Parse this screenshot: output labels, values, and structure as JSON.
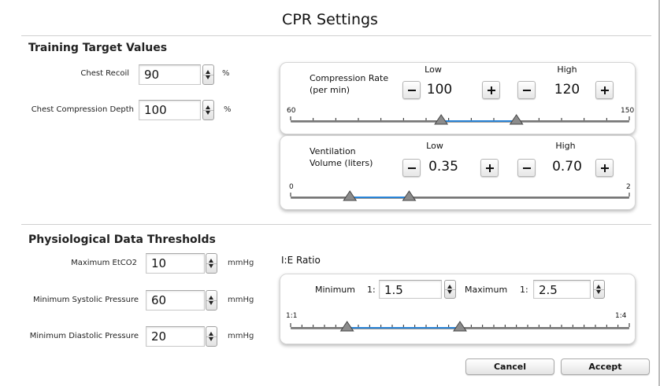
{
  "dialog": {
    "title": "CPR Settings"
  },
  "training": {
    "title": "Training Target Values",
    "chest_recoil": {
      "label": "Chest Recoil",
      "value": "90",
      "unit": "%"
    },
    "compression_depth": {
      "label": "Chest Compression Depth",
      "value": "100",
      "unit": "%"
    },
    "compression_rate": {
      "label_line1": "Compression Rate",
      "label_line2": "(per min)",
      "low_header": "Low",
      "high_header": "High",
      "low": "100",
      "high": "120",
      "min_label": "60",
      "max_label": "150",
      "range": [
        60,
        150
      ],
      "selected": [
        100,
        120
      ]
    },
    "ventilation_volume": {
      "label_line1": "Ventilation",
      "label_line2": "Volume (liters)",
      "low_header": "Low",
      "high_header": "High",
      "low": "0.35",
      "high": "0.70",
      "min_label": "0",
      "max_label": "2",
      "range": [
        0,
        2
      ],
      "selected": [
        0.35,
        0.7
      ]
    }
  },
  "physiological": {
    "title": "Physiological Data Thresholds",
    "max_etco2": {
      "label": "Maximum EtCO2",
      "value": "10",
      "unit": "mmHg"
    },
    "min_systolic": {
      "label": "Minimum Systolic Pressure",
      "value": "60",
      "unit": "mmHg"
    },
    "min_diastolic": {
      "label": "Minimum Diastolic Pressure",
      "value": "20",
      "unit": "mmHg"
    },
    "ie_ratio": {
      "title": "I:E Ratio",
      "min_label": "Minimum",
      "max_label": "Maximum",
      "prefix": "1:",
      "min_value": "1.5",
      "max_value": "2.5",
      "scale_min_label": "1:1",
      "scale_max_label": "1:4",
      "range": [
        1,
        4
      ],
      "selected": [
        1.5,
        2.5
      ]
    }
  },
  "buttons": {
    "cancel": "Cancel",
    "accept": "Accept"
  },
  "colors": {
    "accent": "#2a84d6",
    "track": "#7a7a7a",
    "thumb": "#8c8c8c"
  }
}
